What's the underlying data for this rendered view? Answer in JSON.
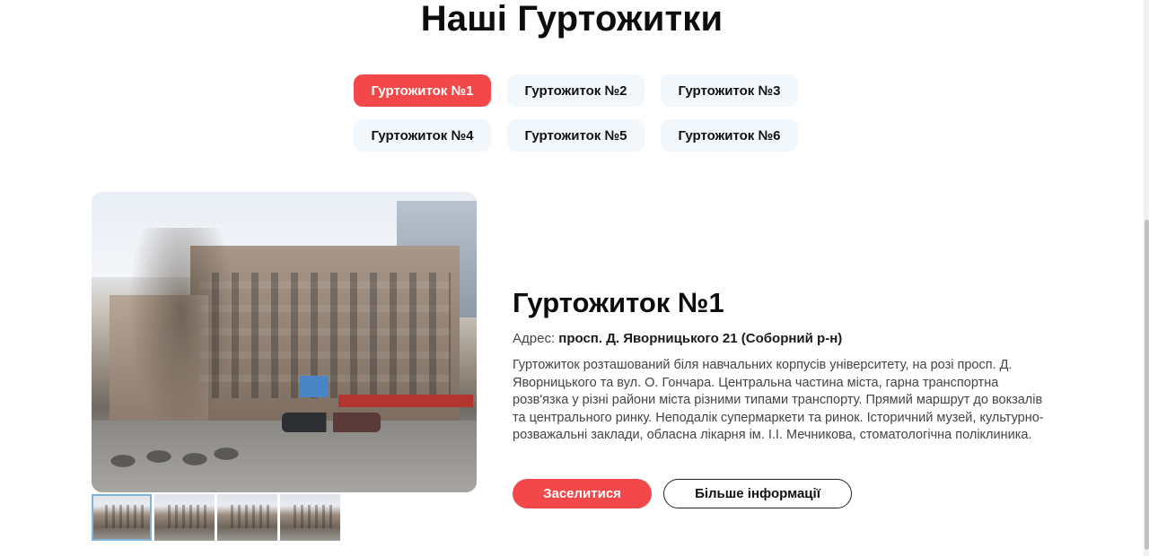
{
  "page": {
    "title": "Наші Гуртожитки"
  },
  "tabs": [
    {
      "label": "Гуртожиток №1",
      "active": true
    },
    {
      "label": "Гуртожиток №2",
      "active": false
    },
    {
      "label": "Гуртожиток №3",
      "active": false
    },
    {
      "label": "Гуртожиток №4",
      "active": false
    },
    {
      "label": "Гуртожиток №5",
      "active": false
    },
    {
      "label": "Гуртожиток №6",
      "active": false
    }
  ],
  "dorm": {
    "title": "Гуртожиток №1",
    "address_label": "Адрес:",
    "address_value": "просп. Д. Яворницького 21 (Соборний р-н)",
    "description": "Гуртожиток розташований біля навчальних корпусів університету, на розі просп. Д. Яворницького та вул. О. Гончара. Центральна частина міста, гарна транспортна розв'язка у різні райони міста різними типами транспорту. Прямий маршрут до вокзалів та центрального ринку. Неподалік супермаркети та ринок. Історичний музей, культурно-розважальні заклади, обласна лікарня ім. І.І. Мечникова, стоматологічна поліклиника.",
    "thumbnail_count": 4,
    "active_thumbnail": 1
  },
  "buttons": {
    "settle": "Заселитися",
    "more_info": "Більше інформації"
  },
  "colors": {
    "accent": "#f2484a",
    "tab_bg": "#f2f7fb",
    "text_dark": "#0d0d0d",
    "text_muted": "#444444"
  }
}
